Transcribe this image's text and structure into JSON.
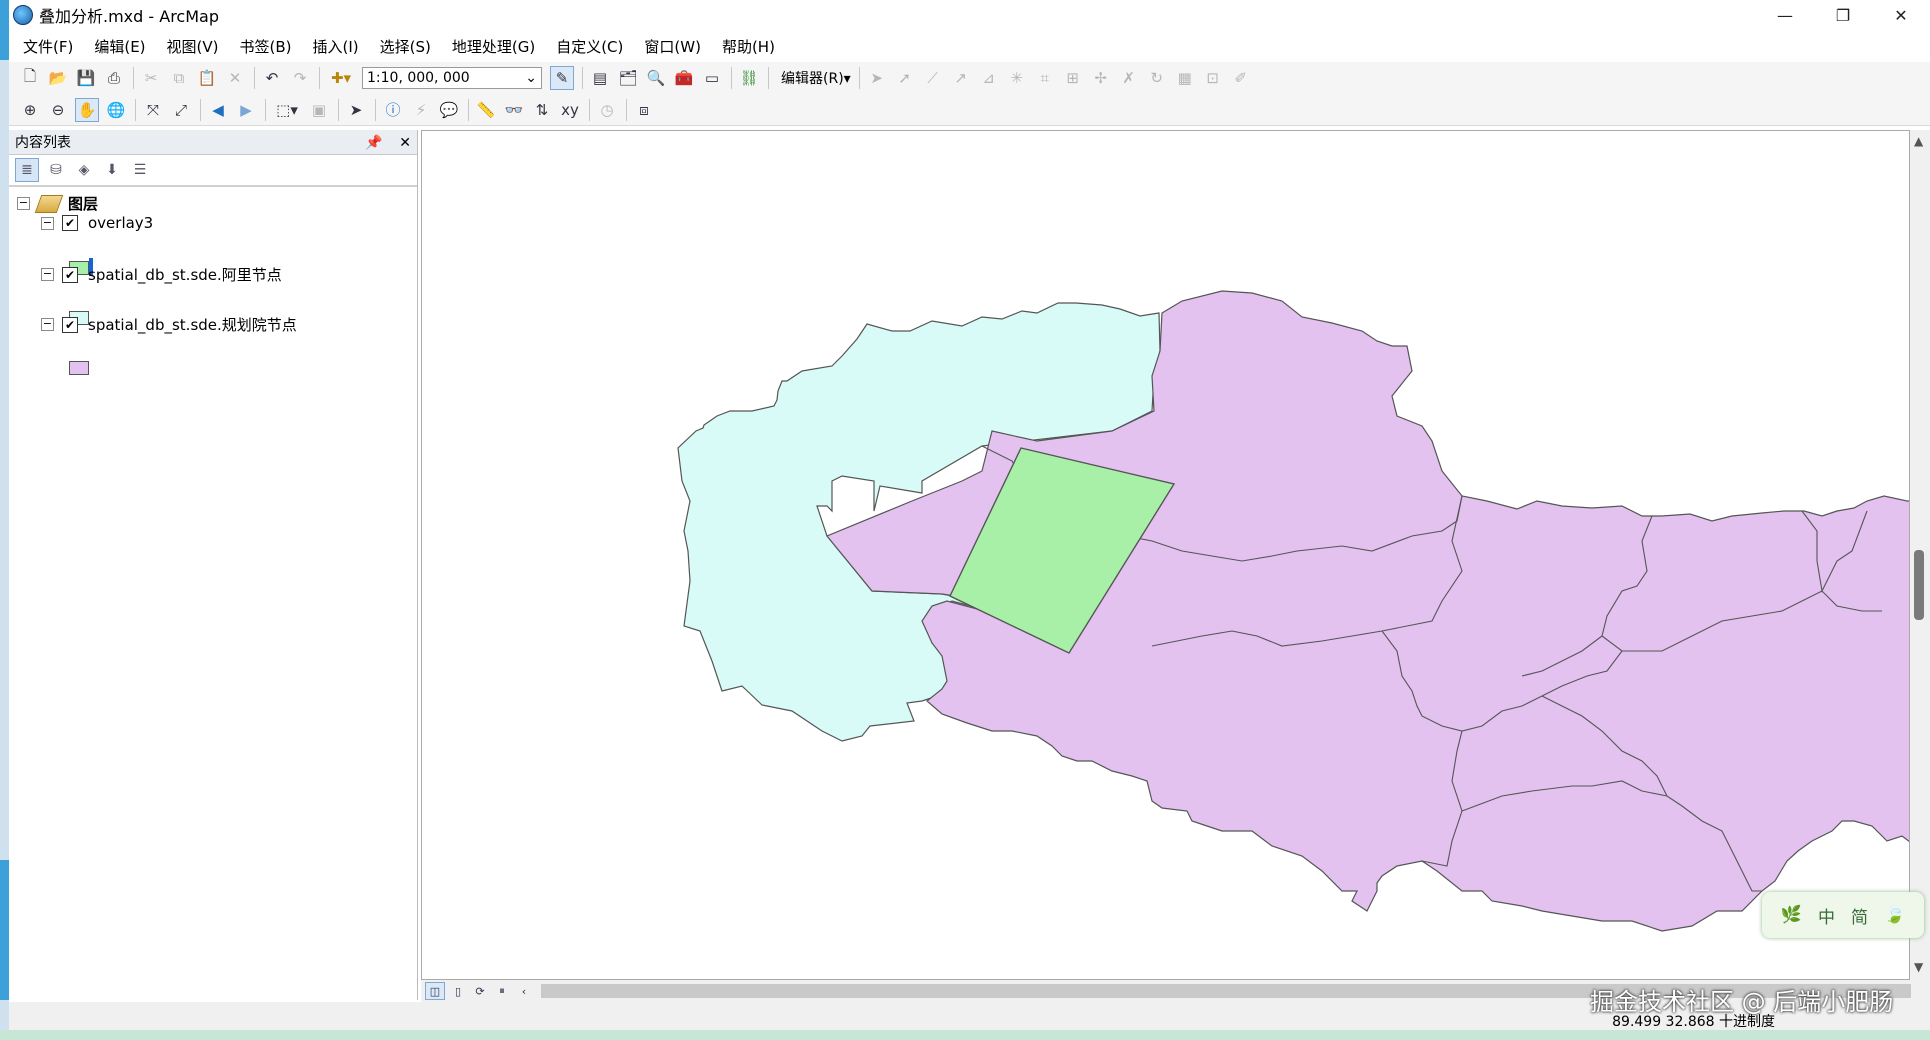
{
  "window": {
    "title": "叠加分析.mxd - ArcMap",
    "controls": {
      "minimize": "—",
      "restore": "❐",
      "close": "✕"
    }
  },
  "menu": [
    "文件(F)",
    "编辑(E)",
    "视图(V)",
    "书签(B)",
    "插入(I)",
    "选择(S)",
    "地理处理(G)",
    "自定义(C)",
    "窗口(W)",
    "帮助(H)"
  ],
  "toolbar": {
    "scale_value": "1:10, 000, 000",
    "editor_label": "编辑器(R)▾"
  },
  "toc": {
    "title": "内容列表",
    "root": "图层",
    "layers": [
      {
        "name": "overlay3",
        "checked": true,
        "color": "#a8f0a8"
      },
      {
        "name": "spatial_db_st.sde.阿里节点",
        "checked": true,
        "color": "#d8fbf8"
      },
      {
        "name": "spatial_db_st.sde.规划院节点",
        "checked": true,
        "color": "#e3c2f0"
      }
    ]
  },
  "status": {
    "coordinates": "89.499  32.868 十进制度"
  },
  "watermark": "掘金技术社区 @ 后端小肥肠",
  "ime": {
    "a": "中",
    "b": "简"
  },
  "colors": {
    "overlay": "#a8f0a8",
    "ali_region": "#d8fbf8",
    "plan_region": "#e3c2f0",
    "outline": "#555555"
  }
}
